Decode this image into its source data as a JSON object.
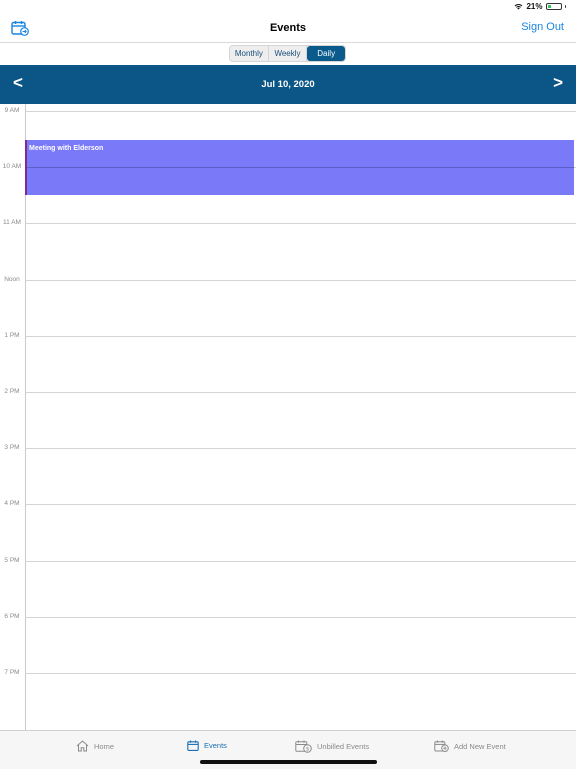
{
  "status_bar": {
    "battery": "21%"
  },
  "nav": {
    "title": "Events",
    "sign_out": "Sign Out",
    "left_icon": "calendar-arrow-icon"
  },
  "segments": [
    {
      "label": "Monthly",
      "active": false
    },
    {
      "label": "Weekly",
      "active": false
    },
    {
      "label": "Daily",
      "active": true
    }
  ],
  "date_bar": {
    "prev": "<",
    "label": "Jul 10, 2020",
    "next": ">"
  },
  "hours": [
    "9 AM",
    "10 AM",
    "11 AM",
    "Noon",
    "1 PM",
    "2 PM",
    "3 PM",
    "4 PM",
    "5 PM",
    "6 PM",
    "7 PM"
  ],
  "event": {
    "title": "Meeting with Elderson",
    "color": "#7a7af9"
  },
  "tabs": [
    {
      "label": "Home",
      "icon": "home-icon",
      "active": false
    },
    {
      "label": "Events",
      "icon": "calendar-icon",
      "active": true
    },
    {
      "label": "Unbilled Events",
      "icon": "calendar-dollar-icon",
      "active": false
    },
    {
      "label": "Add New Event",
      "icon": "calendar-plus-icon",
      "active": false
    }
  ],
  "colors": {
    "accent": "#1a84e0",
    "header": "#0b5687",
    "active_tab": "#1a6fb4",
    "event": "#7a7af9"
  }
}
